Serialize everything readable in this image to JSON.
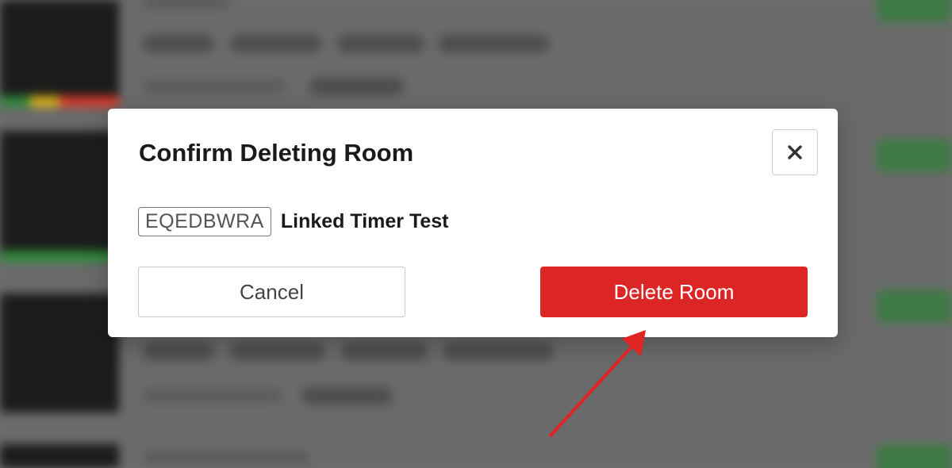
{
  "dialog": {
    "title": "Confirm Deleting Room",
    "close_symbol": "✕",
    "room_code": "EQEDBWRA",
    "room_name": "Linked Timer Test",
    "cancel_label": "Cancel",
    "delete_label": "Delete Room"
  },
  "colors": {
    "danger": "#dc2626",
    "annotation_arrow": "#e02424"
  },
  "icons": {
    "close": "close-icon",
    "annotation": "arrow-annotation"
  }
}
